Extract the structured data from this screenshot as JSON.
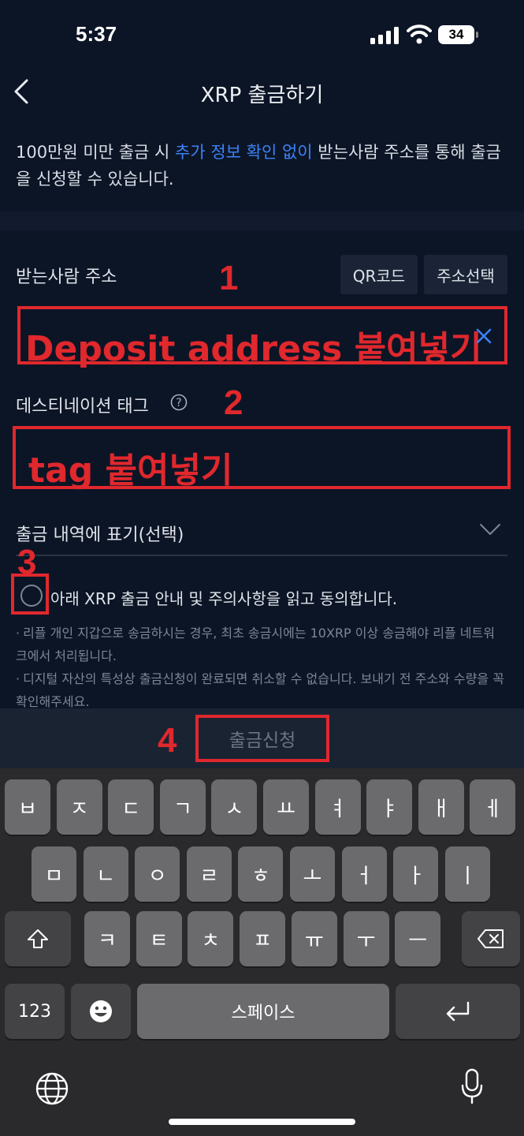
{
  "status_bar": {
    "time": "5:37",
    "battery": "34"
  },
  "header": {
    "title": "XRP 출금하기"
  },
  "notice": {
    "part1": "100만원 미만 출금 시 ",
    "highlight": "추가 정보 확인 없이",
    "part2": " 받는사람 주소를 통해 출금을 신청할 수 있습니다."
  },
  "recipient": {
    "label": "받는사람 주소",
    "qr_button": "QR코드",
    "select_button": "주소선택",
    "annotation": "Deposit address 붙여넣기"
  },
  "tag": {
    "label": "데스티네이션 태그",
    "annotation": "tag 붙여넣기"
  },
  "memo": {
    "label": "출금 내역에 표기(선택)"
  },
  "agree": {
    "label": "아래 XRP 출금 안내 및 주의사항을 읽고 동의합니다."
  },
  "notes": [
    "리플 개인 지갑으로 송금하시는 경우, 최초 송금시에는 10XRP 이상 송금해야 리플 네트워크에서 처리됩니다.",
    "디지털 자산의 특성상 출금신청이 완료되면 취소할 수 없습니다. 보내기 전 주소와 수량을 꼭 확인해주세요."
  ],
  "submit": {
    "label": "출금신청"
  },
  "step_numbers": [
    "1",
    "2",
    "3",
    "4"
  ],
  "keyboard": {
    "row1": [
      "ㅂ",
      "ㅈ",
      "ㄷ",
      "ㄱ",
      "ㅅ",
      "ㅛ",
      "ㅕ",
      "ㅑ",
      "ㅐ",
      "ㅔ"
    ],
    "row2": [
      "ㅁ",
      "ㄴ",
      "ㅇ",
      "ㄹ",
      "ㅎ",
      "ㅗ",
      "ㅓ",
      "ㅏ",
      "ㅣ"
    ],
    "row3": [
      "ㅋ",
      "ㅌ",
      "ㅊ",
      "ㅍ",
      "ㅠ",
      "ㅜ",
      "ㅡ"
    ],
    "numbers_key": "123",
    "space_key": "스페이스"
  },
  "colors": {
    "accent_blue": "#3c82f6",
    "annotation_red": "#e0282d",
    "background": "#0c1526"
  }
}
